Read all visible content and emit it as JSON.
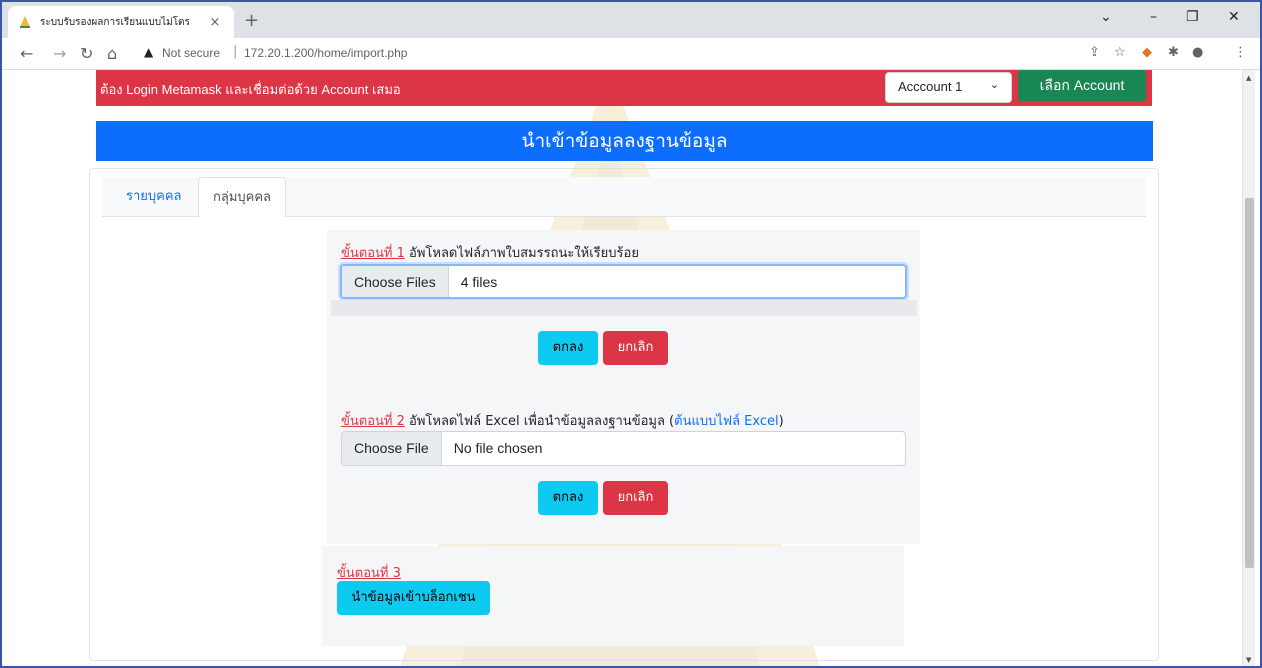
{
  "browser": {
    "tab_title": "ระบบรับรองผลการเรียนแบบไม่โตร",
    "tab_close": "×",
    "new_tab": "+",
    "not_secure": "Not secure",
    "url": "172.20.1.200/home/import.php",
    "window_controls": {
      "dropdown": "⌄",
      "minimize": "–",
      "restore": "❐",
      "close": "✕"
    }
  },
  "alert": {
    "message": "ต้อง Login Metamask และเชื่อมต่อด้วย Account เสมอ",
    "account_select": "Acccount 1",
    "select_account_button": "เลือก Account"
  },
  "page": {
    "title": "นำเข้าข้อมูลลงฐานข้อมูล",
    "tabs": [
      {
        "label": "รายบุคคล"
      },
      {
        "label": "กลุ่มบุคคล"
      }
    ]
  },
  "step1": {
    "number": "ขั้นตอนที่ 1",
    "text": "อัพโหลดไฟล์ภาพใบสมรรถนะให้เรียบร้อย",
    "choose_label": "Choose Files",
    "value": "4 files",
    "ok_button": "ตกลง",
    "cancel_button": "ยกเลิก"
  },
  "step2": {
    "number": "ขั้นตอนที่ 2",
    "text": "อัพโหลดไฟล์ Excel เพื่อนำข้อมูลลงฐานข้อมูล (",
    "link": "ต้นแบบไฟล์ Excel",
    "text_end": ")",
    "choose_label": "Choose File",
    "value": "No file chosen",
    "ok_button": "ตกลง",
    "cancel_button": "ยกเลิก"
  },
  "step3": {
    "number": "ขั้นตอนที่ 3",
    "button": "นำข้อมูลเข้าบล็อกเชน"
  },
  "colors": {
    "alert_red": "#dc3545",
    "header_blue": "#0d6efd",
    "success_green": "#198754",
    "info_cyan": "#0dcaf0"
  }
}
